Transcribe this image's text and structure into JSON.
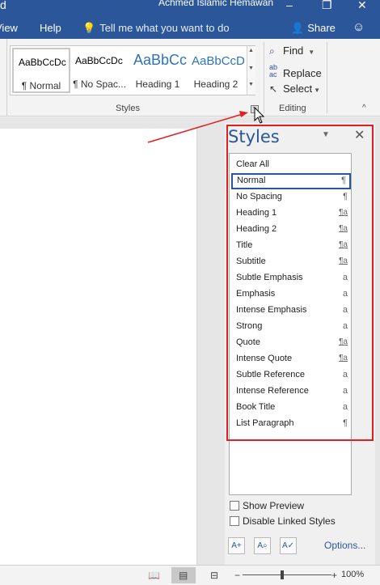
{
  "window": {
    "title_fragment": "Achmed Islamic Hemawan",
    "title_leading_glyph": "d",
    "minimize_glyph": "–",
    "restore_glyph": "❐",
    "close_glyph": "✕"
  },
  "ribbon_tabs": {
    "view": "View",
    "help": "Help",
    "tell_me": "Tell me what you want to do",
    "share": "Share"
  },
  "style_gallery": {
    "items": [
      {
        "sample": "AaBbCcDc",
        "label": "¶ Normal"
      },
      {
        "sample": "AaBbCcDc",
        "label": "¶ No Spac..."
      },
      {
        "sample": "AaBbCc",
        "label": "Heading 1"
      },
      {
        "sample": "AaBbCcD",
        "label": "Heading 2"
      }
    ],
    "group_label": "Styles"
  },
  "editing": {
    "find": "Find",
    "replace": "Replace",
    "select": "Select",
    "group_label": "Editing"
  },
  "styles_pane": {
    "title": "Styles",
    "items": [
      {
        "name": "Clear All",
        "mark": ""
      },
      {
        "name": "Normal",
        "mark": "¶",
        "selected": true
      },
      {
        "name": "No Spacing",
        "mark": "¶"
      },
      {
        "name": "Heading 1",
        "mark": "¶a"
      },
      {
        "name": "Heading 2",
        "mark": "¶a"
      },
      {
        "name": "Title",
        "mark": "¶a"
      },
      {
        "name": "Subtitle",
        "mark": "¶a"
      },
      {
        "name": "Subtle Emphasis",
        "mark": "a"
      },
      {
        "name": "Emphasis",
        "mark": "a"
      },
      {
        "name": "Intense Emphasis",
        "mark": "a"
      },
      {
        "name": "Strong",
        "mark": "a"
      },
      {
        "name": "Quote",
        "mark": "¶a"
      },
      {
        "name": "Intense Quote",
        "mark": "¶a"
      },
      {
        "name": "Subtle Reference",
        "mark": "a"
      },
      {
        "name": "Intense Reference",
        "mark": "a"
      },
      {
        "name": "Book Title",
        "mark": "a"
      },
      {
        "name": "List Paragraph",
        "mark": "¶"
      }
    ],
    "show_preview": "Show Preview",
    "show_preview_checked": false,
    "disable_linked": "Disable Linked Styles",
    "disable_linked_checked": false,
    "options": "Options..."
  },
  "statusbar": {
    "zoom_label": "100%",
    "zoom_minus": "−",
    "zoom_plus": "+"
  },
  "colors": {
    "accent": "#2b579a",
    "annotation": "#e02020"
  }
}
